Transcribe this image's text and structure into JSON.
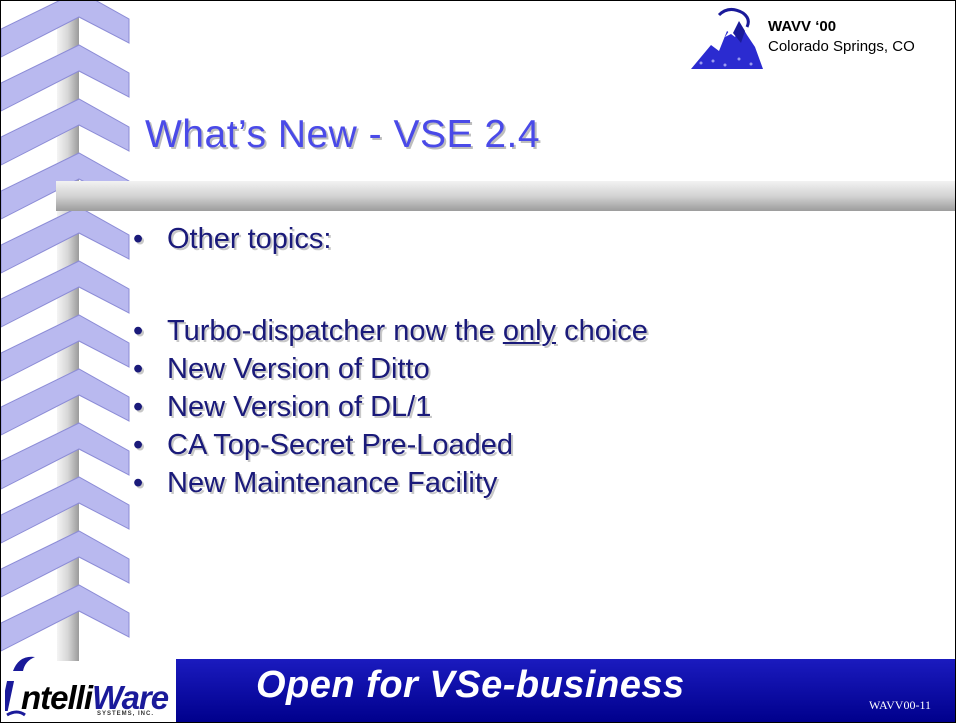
{
  "conference": {
    "name": "WAVV ‘00",
    "location": "Colorado Springs, CO"
  },
  "title": "What’s New - VSE 2.4",
  "intro": "Other topics:",
  "bullets": [
    {
      "pre": "Turbo-dispatcher now the ",
      "em": "only",
      "post": " choice"
    },
    {
      "pre": "New Version of Ditto"
    },
    {
      "pre": "New Version of DL/1"
    },
    {
      "pre": "CA Top-Secret Pre-Loaded"
    },
    {
      "pre": "New Maintenance Facility"
    }
  ],
  "footer": {
    "slogan": "Open for VSe-business",
    "page": "WAVV00-11"
  },
  "logo": {
    "brand_prefix": "ntelli",
    "brand_suffix": "Ware",
    "tagline": "SYSTEMS, INC."
  },
  "colors": {
    "title": "#4a4ae8",
    "text": "#1a1a7a",
    "footer": "#00008c",
    "spiral": "#b9b9ef"
  }
}
